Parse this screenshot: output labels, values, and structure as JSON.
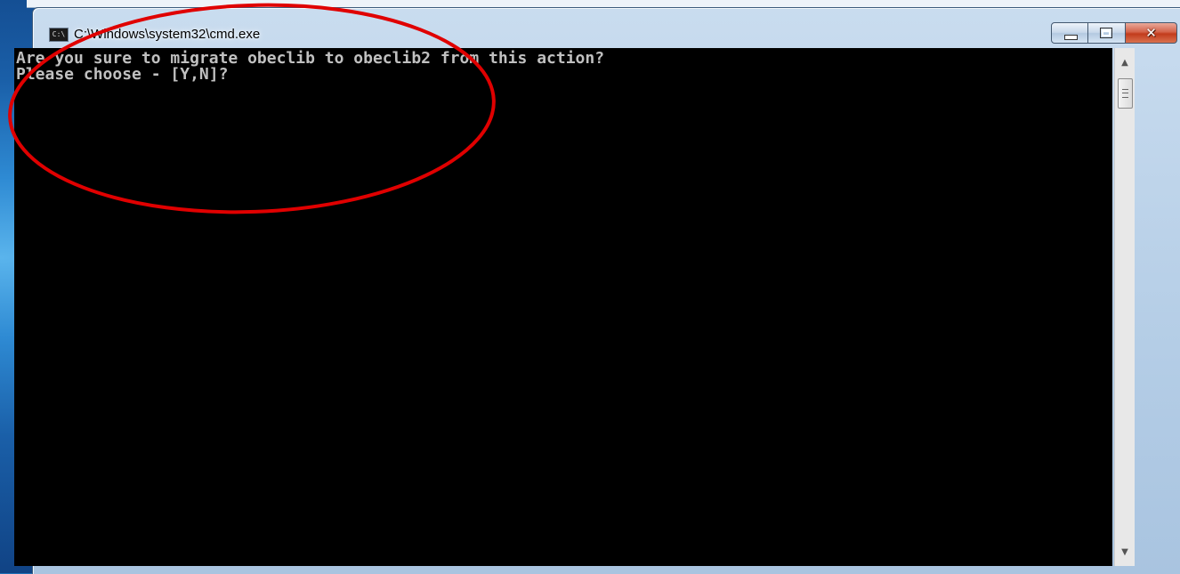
{
  "window": {
    "title": "C:\\Windows\\system32\\cmd.exe",
    "icon_label": "C:\\"
  },
  "caption_buttons": {
    "close_glyph": "✕"
  },
  "console": {
    "lines": [
      "Are you sure to migrate obeclib to obeclib2 from this action?",
      "Please choose - [Y,N]?"
    ]
  },
  "scrollbar": {
    "up_glyph": "▲",
    "down_glyph": "▼"
  },
  "colors": {
    "console_background": "#000000",
    "console_text": "#c0c0c0",
    "annotation": "#e00000",
    "close_button": "#c23b1c"
  },
  "icons": [
    "cmd-app-icon",
    "minimize-icon",
    "maximize-icon",
    "close-icon",
    "scroll-up-icon",
    "scroll-down-icon"
  ]
}
